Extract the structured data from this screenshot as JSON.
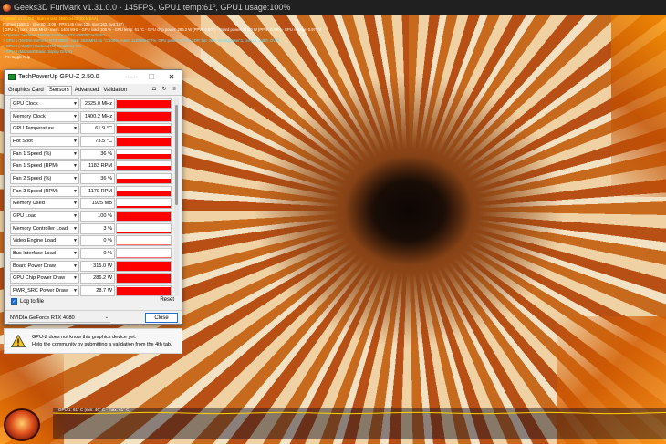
{
  "furmark": {
    "title": "Geeks3D FurMark v1.31.0.0 - 145FPS, GPU1 temp:61º, GPU1 usage:100%",
    "osd": [
      {
        "text": "FurMark v1.31.0.0 - Burn-in test, 2560x1440 (0X MSAA)",
        "color": "yellow"
      },
      {
        "text": "Frames:155811 - time:00:13:09 - FPS:145 (min:125, max:163, avg:147)",
        "color": "white"
      },
      {
        "text": "[ GPU-Z ] core: 2625 MHz - mem: 1400 MHz - GPU load: 100 % - GPU temp: 61 °C - GPU chip power: 286.2 W (PPW: 0.507) - Board power: 315.0 W (PPW: 0.460) - GPU voltage: 0.970 V",
        "color": "white"
      },
      {
        "text": "> OpenGL renderer: NVIDIA GeForce RTX 4080/PCIe/SSE2",
        "color": "cyan"
      },
      {
        "text": "> GPU 1 (NVIDIA GeForce RTX 4080) - core: 2625MHz:61 °C:100%, mem: 11200MHz:7%, GPU power: 97.7% TDP, fan: 36%, limits:[power:1, temp:0, volt:0, OV:0]",
        "color": "cyan"
      },
      {
        "text": "> GPU 2 (AMD(R) Radeon(TM) Graphics): 0%",
        "color": "cyan"
      },
      {
        "text": "> GPU 3 (Microsoft Basic Display Driver)",
        "color": "cyan"
      },
      {
        "text": "- F1: toggle help",
        "color": "white"
      }
    ],
    "graph_label": "GPU 1: 61° C (min: 46° C - max: 61° C)",
    "graph_color": "#ffd200"
  },
  "gpuz": {
    "title": "TechPowerUp GPU-Z 2.50.0",
    "controls": {
      "minimize": "—",
      "maximize": "☐",
      "close": "✕"
    },
    "tabs": [
      {
        "label": "Graphics Card",
        "active": false
      },
      {
        "label": "Sensors",
        "active": true
      },
      {
        "label": "Advanced",
        "active": false
      },
      {
        "label": "Validation",
        "active": false
      }
    ],
    "tool_icons": [
      "camera-icon",
      "refresh-icon",
      "menu-icon"
    ],
    "tool_glyphs": [
      "◘",
      "↻",
      "≡"
    ],
    "sensors": [
      {
        "name": "GPU Clock",
        "value": "2625.0 MHz",
        "level": 0.92
      },
      {
        "name": "Memory Clock",
        "value": "1400.2 MHz",
        "level": 0.92
      },
      {
        "name": "GPU Temperature",
        "value": "61.9 °C",
        "level": 0.85
      },
      {
        "name": "Hot Spot",
        "value": "73.5 °C",
        "level": 0.85
      },
      {
        "name": "Fan 1 Speed (%)",
        "value": "36 %",
        "level": 0.5
      },
      {
        "name": "Fan 1 Speed (RPM)",
        "value": "1183 RPM",
        "level": 0.5
      },
      {
        "name": "Fan 2 Speed (%)",
        "value": "36 %",
        "level": 0.5
      },
      {
        "name": "Fan 2 Speed (RPM)",
        "value": "1179 RPM",
        "level": 0.45
      },
      {
        "name": "Memory Used",
        "value": "1925 MB",
        "level": 0.2
      },
      {
        "name": "GPU Load",
        "value": "100 %",
        "level": 0.95
      },
      {
        "name": "Memory Controller Load",
        "value": "3 %",
        "level": 0.05
      },
      {
        "name": "Video Engine Load",
        "value": "0 %",
        "level": 0.0
      },
      {
        "name": "Bus Interface Load",
        "value": "0 %",
        "level": 0.0
      },
      {
        "name": "Board Power Draw",
        "value": "315.0 W",
        "level": 0.95
      },
      {
        "name": "GPU Chip Power Draw",
        "value": "286.2 W",
        "level": 0.95
      },
      {
        "name": "PWR_SRC Power Draw",
        "value": "28.7 W",
        "level": 0.95
      }
    ],
    "log_label": "Log to file",
    "log_checked": true,
    "reset_label": "Reset",
    "gpu_selected": "NVIDIA GeForce RTX 4080",
    "close_label": "Close",
    "accent": "#ff0000"
  },
  "notice": {
    "line1": "GPU-Z does not know this graphics device yet.",
    "line2": "Help the community by submitting a validation from the 4th tab.",
    "icon": "warning-icon"
  }
}
